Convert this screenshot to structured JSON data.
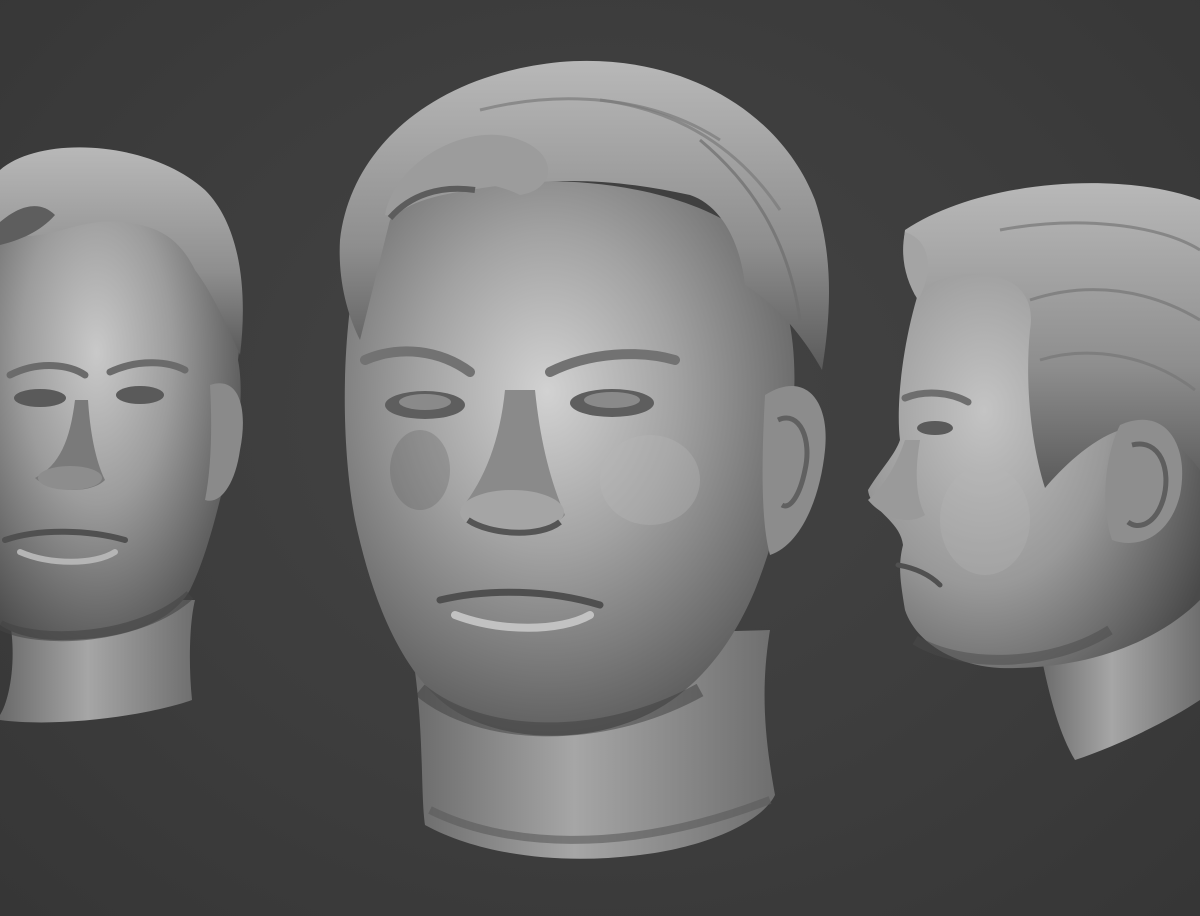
{
  "scene": {
    "background_color": "#3c3c3c",
    "material_color": "#9a9a9a",
    "views": [
      {
        "name": "three-quarter-left-view"
      },
      {
        "name": "front-three-quarter-view"
      },
      {
        "name": "profile-view"
      }
    ]
  }
}
